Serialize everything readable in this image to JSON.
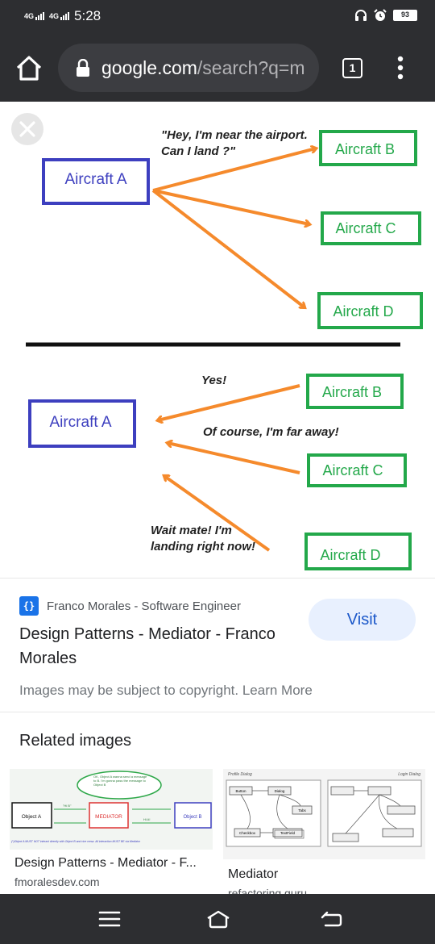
{
  "status_bar": {
    "network_1": "4G",
    "network_2": "4G",
    "time": "5:28",
    "battery": "93",
    "icons": [
      "signal-icon",
      "headphones-icon",
      "alarm-icon",
      "battery-icon"
    ]
  },
  "browser": {
    "url_host": "google.com",
    "url_path": "/search?q=m",
    "tab_count": "1",
    "icons": [
      "home-icon",
      "lock-icon",
      "tab-switcher-icon",
      "more-vert-icon"
    ]
  },
  "image_viewer": {
    "close_icon": "close-icon",
    "top": {
      "sender": "Aircraft A",
      "message": "\"Hey, I'm near the airport.",
      "message_2": "Can I land ?\"",
      "receivers": [
        "Aircraft B",
        "Aircraft C",
        "Aircraft D"
      ]
    },
    "bottom": {
      "receiver": "Aircraft A",
      "reply_b": "Yes!",
      "reply_c": "Of course, I'm far away!",
      "reply_d_1": "Wait mate! I'm",
      "reply_d_2": "landing right now!",
      "senders": [
        "Aircraft B",
        "Aircraft C",
        "Aircraft D"
      ]
    },
    "colors": {
      "sender_border": "#3d3fbf",
      "receiver_border": "#23a84a",
      "arrow": "#f58a2c",
      "divider": "#111111"
    }
  },
  "result": {
    "source_icon": "{}",
    "source_name": "Franco Morales - Software Engineer",
    "title": "Design Patterns - Mediator - Franco Morales",
    "visit_label": "Visit",
    "copyright": "Images may be subject to copyright. Learn More"
  },
  "related": {
    "heading": "Related images",
    "items": [
      {
        "title": "Design Patterns - Mediator - F...",
        "source": "fmoralesdev.com",
        "thumb": {
          "bubble": "OK, Object A wanna send a message to B. I'm gonna pass the message to Object B",
          "hi_label": "\"Hi B\"",
          "hi_a": "Hi A!",
          "object_a": "Object A",
          "mediator": "MEDIATOR",
          "object_b": "Object B",
          "footer": "(*)Object A MUST NOT interact directly with Object B and vice versa. All interaction MUST BE via Mediator"
        }
      },
      {
        "title": "Mediator",
        "source": "refactoring.guru",
        "thumb": {
          "left_caption": "Profile Dialog",
          "right_caption": "Login Dialog",
          "button": "Button",
          "dialog": "Dialog",
          "tabs": "Tabs",
          "checkbox": "Checkbox",
          "textfield": "TextField"
        }
      }
    ]
  },
  "nav_bar": {
    "icons": [
      "recents-menu-icon",
      "home-nav-icon",
      "back-icon"
    ]
  }
}
